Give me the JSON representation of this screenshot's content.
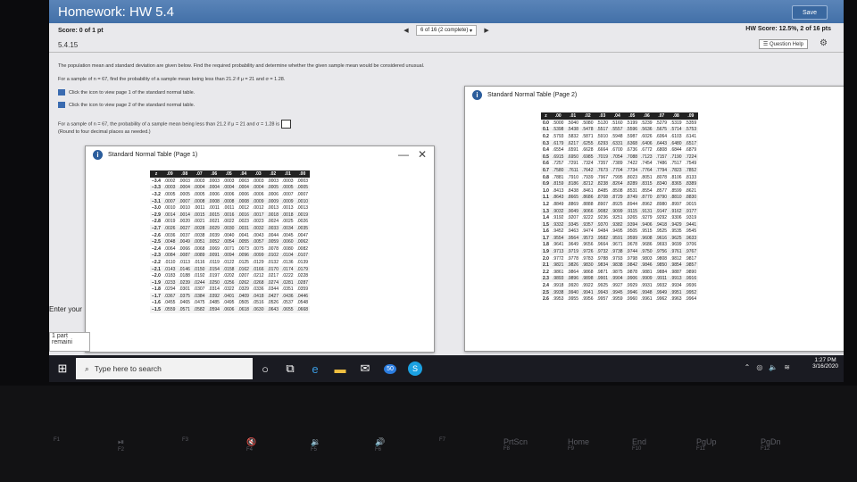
{
  "header": {
    "title": "Homework: HW 5.4",
    "save_label": "Save"
  },
  "score": {
    "label": "Score: 0 of 1 pt",
    "progress": "6 of 16 (2 complete)",
    "hw_score": "HW Score: 12.5%, 2 of 16 pts"
  },
  "question": {
    "id": "5.4.15",
    "help": "Question Help"
  },
  "prompt": {
    "line1": "The population mean and standard deviation are given below. Find the required probability and determine whether the given sample mean would be considered unusual.",
    "line2": "For a sample of n = 67, find the probability of a sample mean being less than 21.2 if μ = 21 and σ = 1.28.",
    "link1": "Click the icon to view page 1 of the standard normal table.",
    "link2": "Click the icon to view page 2 of the standard normal table.",
    "line3": "For a sample of n = 67, the probability of a sample mean being less than 21.2 if μ = 21 and σ = 1.28 is",
    "line4": "(Round to four decimal places as needed.)"
  },
  "table1": {
    "title": "Standard Normal Table (Page 1)",
    "headers": [
      "z",
      ".09",
      ".08",
      ".07",
      ".06",
      ".05",
      ".04",
      ".03",
      ".02",
      ".01",
      ".00"
    ],
    "rows": [
      [
        "−3.4",
        ".0002",
        ".0003",
        ".0003",
        ".0003",
        ".0003",
        ".0003",
        ".0003",
        ".0003",
        ".0003",
        ".0003"
      ],
      [
        "−3.3",
        ".0003",
        ".0004",
        ".0004",
        ".0004",
        ".0004",
        ".0004",
        ".0004",
        ".0005",
        ".0005",
        ".0005"
      ],
      [
        "−3.2",
        ".0005",
        ".0005",
        ".0005",
        ".0006",
        ".0006",
        ".0006",
        ".0006",
        ".0006",
        ".0007",
        ".0007"
      ],
      [
        "−3.1",
        ".0007",
        ".0007",
        ".0008",
        ".0008",
        ".0008",
        ".0008",
        ".0009",
        ".0009",
        ".0009",
        ".0010"
      ],
      [
        "−3.0",
        ".0010",
        ".0010",
        ".0011",
        ".0011",
        ".0011",
        ".0012",
        ".0012",
        ".0013",
        ".0013",
        ".0013"
      ],
      [
        "−2.9",
        ".0014",
        ".0014",
        ".0015",
        ".0015",
        ".0016",
        ".0016",
        ".0017",
        ".0018",
        ".0018",
        ".0019"
      ],
      [
        "−2.8",
        ".0019",
        ".0020",
        ".0021",
        ".0021",
        ".0022",
        ".0023",
        ".0023",
        ".0024",
        ".0025",
        ".0026"
      ],
      [
        "−2.7",
        ".0026",
        ".0027",
        ".0028",
        ".0029",
        ".0030",
        ".0031",
        ".0032",
        ".0033",
        ".0034",
        ".0035"
      ],
      [
        "−2.6",
        ".0036",
        ".0037",
        ".0038",
        ".0039",
        ".0040",
        ".0041",
        ".0043",
        ".0044",
        ".0045",
        ".0047"
      ],
      [
        "−2.5",
        ".0048",
        ".0049",
        ".0051",
        ".0052",
        ".0054",
        ".0055",
        ".0057",
        ".0059",
        ".0060",
        ".0062"
      ],
      [
        "−2.4",
        ".0064",
        ".0066",
        ".0068",
        ".0069",
        ".0071",
        ".0073",
        ".0075",
        ".0078",
        ".0080",
        ".0082"
      ],
      [
        "−2.3",
        ".0084",
        ".0087",
        ".0089",
        ".0091",
        ".0094",
        ".0096",
        ".0099",
        ".0102",
        ".0104",
        ".0107"
      ],
      [
        "−2.2",
        ".0110",
        ".0113",
        ".0116",
        ".0119",
        ".0122",
        ".0125",
        ".0129",
        ".0132",
        ".0136",
        ".0139"
      ],
      [
        "−2.1",
        ".0143",
        ".0146",
        ".0150",
        ".0154",
        ".0158",
        ".0162",
        ".0166",
        ".0170",
        ".0174",
        ".0179"
      ],
      [
        "−2.0",
        ".0183",
        ".0188",
        ".0192",
        ".0197",
        ".0202",
        ".0207",
        ".0212",
        ".0217",
        ".0222",
        ".0228"
      ],
      [
        "−1.9",
        ".0233",
        ".0239",
        ".0244",
        ".0250",
        ".0256",
        ".0262",
        ".0268",
        ".0274",
        ".0281",
        ".0287"
      ],
      [
        "−1.8",
        ".0294",
        ".0301",
        ".0307",
        ".0314",
        ".0322",
        ".0329",
        ".0336",
        ".0344",
        ".0351",
        ".0359"
      ],
      [
        "−1.7",
        ".0367",
        ".0375",
        ".0384",
        ".0392",
        ".0401",
        ".0409",
        ".0418",
        ".0427",
        ".0436",
        ".0446"
      ],
      [
        "−1.6",
        ".0455",
        ".0465",
        ".0475",
        ".0485",
        ".0495",
        ".0505",
        ".0516",
        ".0526",
        ".0537",
        ".0548"
      ],
      [
        "−1.5",
        ".0559",
        ".0571",
        ".0582",
        ".0594",
        ".0606",
        ".0618",
        ".0630",
        ".0643",
        ".0655",
        ".0668"
      ]
    ]
  },
  "table2": {
    "title": "Standard Normal Table (Page 2)",
    "headers": [
      "z",
      ".00",
      ".01",
      ".02",
      ".03",
      ".04",
      ".05",
      ".06",
      ".07",
      ".08",
      ".09"
    ],
    "rows": [
      [
        "0.0",
        ".5000",
        ".5040",
        ".5080",
        ".5120",
        ".5160",
        ".5199",
        ".5239",
        ".5279",
        ".5319",
        ".5359"
      ],
      [
        "0.1",
        ".5398",
        ".5438",
        ".5478",
        ".5517",
        ".5557",
        ".5596",
        ".5636",
        ".5675",
        ".5714",
        ".5753"
      ],
      [
        "0.2",
        ".5793",
        ".5832",
        ".5871",
        ".5910",
        ".5948",
        ".5987",
        ".6026",
        ".6064",
        ".6103",
        ".6141"
      ],
      [
        "0.3",
        ".6179",
        ".6217",
        ".6255",
        ".6293",
        ".6331",
        ".6368",
        ".6406",
        ".6443",
        ".6480",
        ".6517"
      ],
      [
        "0.4",
        ".6554",
        ".6591",
        ".6628",
        ".6664",
        ".6700",
        ".6736",
        ".6772",
        ".6808",
        ".6844",
        ".6879"
      ],
      [
        "0.5",
        ".6915",
        ".6950",
        ".6985",
        ".7019",
        ".7054",
        ".7088",
        ".7123",
        ".7157",
        ".7190",
        ".7224"
      ],
      [
        "0.6",
        ".7257",
        ".7291",
        ".7324",
        ".7357",
        ".7389",
        ".7422",
        ".7454",
        ".7486",
        ".7517",
        ".7549"
      ],
      [
        "0.7",
        ".7580",
        ".7611",
        ".7642",
        ".7673",
        ".7704",
        ".7734",
        ".7764",
        ".7794",
        ".7823",
        ".7852"
      ],
      [
        "0.8",
        ".7881",
        ".7910",
        ".7939",
        ".7967",
        ".7995",
        ".8023",
        ".8051",
        ".8078",
        ".8106",
        ".8133"
      ],
      [
        "0.9",
        ".8159",
        ".8186",
        ".8212",
        ".8238",
        ".8264",
        ".8289",
        ".8315",
        ".8340",
        ".8365",
        ".8389"
      ],
      [
        "1.0",
        ".8413",
        ".8438",
        ".8461",
        ".8485",
        ".8508",
        ".8531",
        ".8554",
        ".8577",
        ".8599",
        ".8621"
      ],
      [
        "1.1",
        ".8643",
        ".8665",
        ".8686",
        ".8708",
        ".8729",
        ".8749",
        ".8770",
        ".8790",
        ".8810",
        ".8830"
      ],
      [
        "1.2",
        ".8849",
        ".8869",
        ".8888",
        ".8907",
        ".8925",
        ".8944",
        ".8962",
        ".8980",
        ".8997",
        ".9015"
      ],
      [
        "1.3",
        ".9032",
        ".9049",
        ".9066",
        ".9082",
        ".9099",
        ".9115",
        ".9131",
        ".9147",
        ".9162",
        ".9177"
      ],
      [
        "1.4",
        ".9192",
        ".9207",
        ".9222",
        ".9236",
        ".9251",
        ".9265",
        ".9279",
        ".9292",
        ".9306",
        ".9319"
      ],
      [
        "1.5",
        ".9332",
        ".9345",
        ".9357",
        ".9370",
        ".9382",
        ".9394",
        ".9406",
        ".9418",
        ".9429",
        ".9441"
      ],
      [
        "1.6",
        ".9452",
        ".9463",
        ".9474",
        ".9484",
        ".9495",
        ".9505",
        ".9515",
        ".9525",
        ".9535",
        ".9545"
      ],
      [
        "1.7",
        ".9554",
        ".9564",
        ".9573",
        ".9582",
        ".9591",
        ".9599",
        ".9608",
        ".9616",
        ".9625",
        ".9633"
      ],
      [
        "1.8",
        ".9641",
        ".9649",
        ".9656",
        ".9664",
        ".9671",
        ".9678",
        ".9686",
        ".9693",
        ".9699",
        ".9706"
      ],
      [
        "1.9",
        ".9713",
        ".9719",
        ".9726",
        ".9732",
        ".9738",
        ".9744",
        ".9750",
        ".9756",
        ".9761",
        ".9767"
      ],
      [
        "2.0",
        ".9772",
        ".9778",
        ".9783",
        ".9788",
        ".9793",
        ".9798",
        ".9803",
        ".9808",
        ".9812",
        ".9817"
      ],
      [
        "2.1",
        ".9821",
        ".9826",
        ".9830",
        ".9834",
        ".9838",
        ".9842",
        ".9846",
        ".9850",
        ".9854",
        ".9857"
      ],
      [
        "2.2",
        ".9861",
        ".9864",
        ".9868",
        ".9871",
        ".9875",
        ".9878",
        ".9881",
        ".9884",
        ".9887",
        ".9890"
      ],
      [
        "2.3",
        ".9893",
        ".9896",
        ".9898",
        ".9901",
        ".9904",
        ".9906",
        ".9909",
        ".9911",
        ".9913",
        ".9916"
      ],
      [
        "2.4",
        ".9918",
        ".9920",
        ".9922",
        ".9925",
        ".9927",
        ".9929",
        ".9931",
        ".9932",
        ".9934",
        ".9936"
      ],
      [
        "2.5",
        ".9938",
        ".9940",
        ".9941",
        ".9943",
        ".9945",
        ".9946",
        ".9948",
        ".9949",
        ".9951",
        ".9952"
      ],
      [
        "2.6",
        ".9953",
        ".9955",
        ".9956",
        ".9957",
        ".9959",
        ".9960",
        ".9961",
        ".9962",
        ".9963",
        ".9964"
      ]
    ]
  },
  "side": {
    "enter": "Enter your",
    "part": "1 part",
    "remaining": "remaini"
  },
  "taskbar": {
    "search": "Type here to search",
    "time": "1:27 PM",
    "date": "3/16/2020",
    "badge": "50"
  },
  "keyboard": {
    "keys": [
      {
        "top": "",
        "bottom": "F1"
      },
      {
        "top": "⏯",
        "bottom": "F2"
      },
      {
        "top": "",
        "bottom": "F3"
      },
      {
        "top": "🔇",
        "bottom": "F4"
      },
      {
        "top": "🔉",
        "bottom": "F5"
      },
      {
        "top": "🔊",
        "bottom": "F6"
      },
      {
        "top": "",
        "bottom": "F7"
      },
      {
        "top": "PrtScn",
        "bottom": "F8"
      },
      {
        "top": "Home",
        "bottom": "F9"
      },
      {
        "top": "End",
        "bottom": "F10"
      },
      {
        "top": "PgUp",
        "bottom": "F11"
      },
      {
        "top": "PgDn",
        "bottom": "F12"
      }
    ]
  }
}
